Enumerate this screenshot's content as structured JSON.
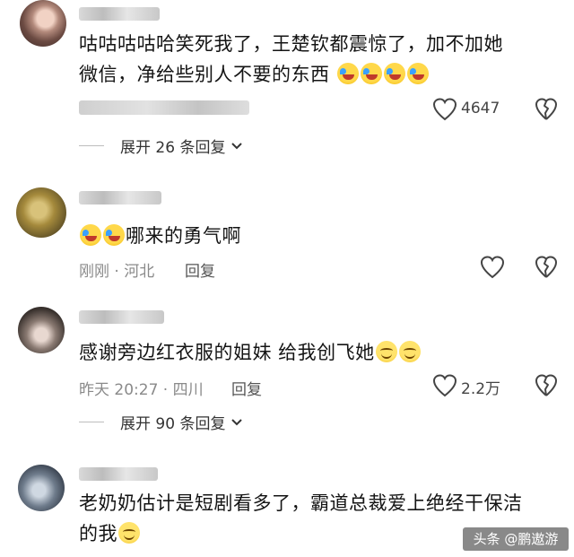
{
  "comments": [
    {
      "text_line1": "咕咕咕咕哈笑死我了，王楚钦都震惊了，加不加她",
      "text_line2": "微信，净给些别人不要的东西",
      "like_count": "4647",
      "expand_label": "展开 26 条回复"
    },
    {
      "text": "哪来的勇气啊",
      "time": "刚刚 · 河北",
      "reply_label": "回复"
    },
    {
      "text": "感谢旁边红衣服的姐妹  给我创飞她",
      "time": "昨天 20:27 · 四川",
      "reply_label": "回复",
      "like_count": "2.2万",
      "expand_label": "展开 90 条回复"
    },
    {
      "text_line1": "老奶奶估计是短剧看多了，霸道总裁爱上绝经干保洁",
      "text_line2": "的我"
    }
  ],
  "watermark": "头条 @鹏遨游",
  "icons": {
    "like": "heart-outline-icon",
    "dislike": "broken-heart-icon",
    "expand": "chevron-down-icon",
    "emoji_laugh": "laughing-crying-emoji-icon",
    "emoji_smile": "smiling-emoji-icon"
  }
}
